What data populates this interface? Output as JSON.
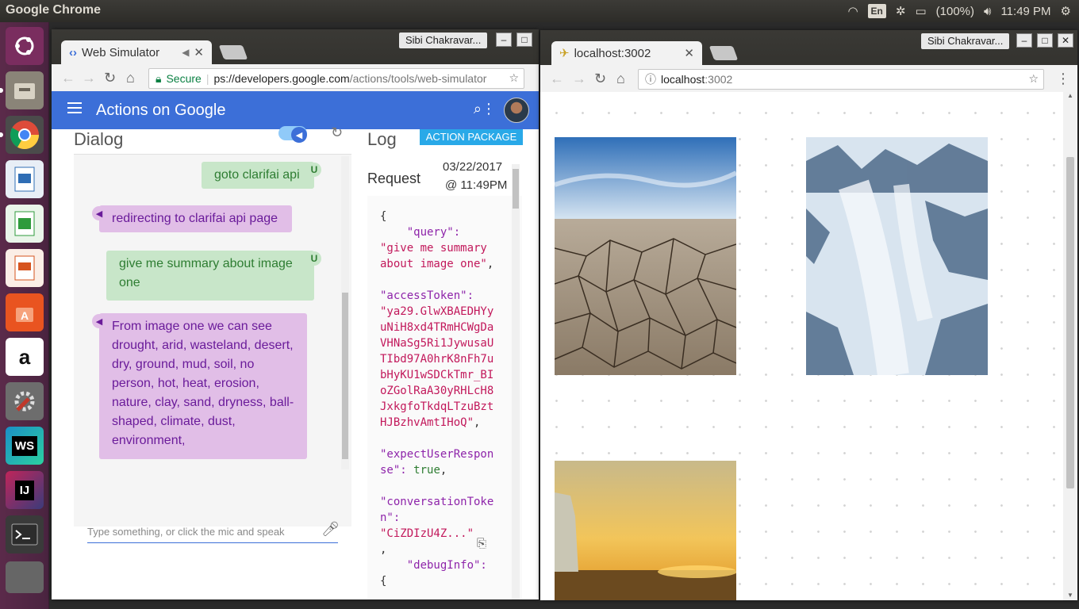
{
  "system": {
    "app_title": "Google Chrome",
    "keyboard_layout": "En",
    "battery": "(100%)",
    "time": "11:49 PM"
  },
  "launcher": {
    "apps": [
      {
        "name": "ubuntu-dash-icon",
        "color": "#7a2d5f"
      },
      {
        "name": "files-icon",
        "color": "#8a8478"
      },
      {
        "name": "chrome-icon",
        "color": "#dd4b39"
      },
      {
        "name": "libreoffice-draw-icon",
        "color": "#2f6db4"
      },
      {
        "name": "libreoffice-calc-icon",
        "color": "#2f9b3c"
      },
      {
        "name": "libreoffice-impress-icon",
        "color": "#d6541f"
      },
      {
        "name": "software-center-icon",
        "color": "#e95420"
      },
      {
        "name": "amazon-icon",
        "color": "#ffffff"
      },
      {
        "name": "system-settings-icon",
        "color": "#b43c3c"
      },
      {
        "name": "webstorm-icon",
        "color": "#1b8ec7"
      },
      {
        "name": "intellij-icon",
        "color": "#3b3b7a"
      },
      {
        "name": "terminal-icon",
        "color": "#2c2c2c"
      }
    ],
    "labels": {
      "ws": "WS",
      "ij": "IJ",
      "amazon": "a"
    }
  },
  "left_window": {
    "user": "Sibi Chakravar...",
    "tab_title": "Web Simulator",
    "secure_label": "Secure",
    "url_prefix": "ps://",
    "url_host": "developers.google.com",
    "url_path": "/actions/tools/web-simulator",
    "header_title": "Actions on Google",
    "dialog_title": "Dialog",
    "action_package_label": "ACTION PACKAGE",
    "messages": [
      {
        "from": "user",
        "text": "goto clarifai api"
      },
      {
        "from": "bot",
        "text": "redirecting to clarifai api page"
      },
      {
        "from": "user",
        "text": "give me summary about image one"
      },
      {
        "from": "bot",
        "text": "From image one we can see drought, arid, wasteland, desert, dry, ground, mud, soil, no person, hot, heat, erosion, nature, clay, sand, dryness, ball-shaped, climate, dust, environment,"
      }
    ],
    "user_badge": "U",
    "input_placeholder": "Type something, or click the mic and speak",
    "log_title": "Log",
    "request_label": "Request",
    "request_date": "03/22/2017",
    "request_time": "@ 11:49PM",
    "json_lines": {
      "open": "{",
      "query_key": "\"query\":",
      "query_val": "\"give me summary\nabout image one\"",
      "token_key": "\"accessToken\":",
      "token_val": "\"ya29.GlwXBAEDHYy\nuNiH8xd4TRmHCWgDa\nVHNaSg5Ri1JywusaU\nTIbd97A0hrK8nFh7u\nbHyKU1wSDCkTmr_BI\noZGolRaA30yRHLcH8\nJxkgfoTkdqLTzuBzt\nHJBzhvAmtIHoQ\"",
      "expect_key": "\"expectUserRespon\nse\":",
      "expect_val": "true",
      "conv_key": "\"conversationToke\nn\":",
      "conv_val": "\"CiZDIzU4Z...\"",
      "debug_key": "\"debugInfo\":",
      "debug_open": "{"
    }
  },
  "right_window": {
    "user": "Sibi Chakravar...",
    "tab_title": "localhost:3002",
    "url_host": "localhost",
    "url_port": ":3002"
  }
}
